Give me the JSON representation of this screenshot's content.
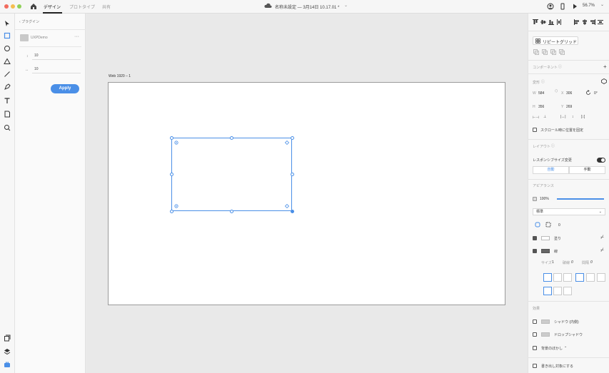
{
  "titlebar": {
    "tabs": [
      "デザイン",
      "プロトタイプ",
      "共有"
    ],
    "document_title": "名称未設定 — 3月14日 10.17.01 *",
    "zoom": "56.7%"
  },
  "plugin_panel": {
    "back_label": "プラグイン",
    "plugin_name": "UXPDemo",
    "more": "···",
    "fields": [
      {
        "label": "↕",
        "value": "10"
      },
      {
        "label": "↔",
        "value": "10"
      }
    ],
    "apply_label": "Apply"
  },
  "canvas": {
    "artboard_label": "Web 1920 – 1"
  },
  "right_panel": {
    "repeat_grid_label": "リピートグリッド",
    "component_label": "コンポーネント",
    "transform_label": "変形",
    "w_label": "W",
    "w_value": "584",
    "x_label": "X",
    "x_value": "306",
    "rotation_value": "0°",
    "h_label": "H",
    "h_value": "356",
    "y_label": "Y",
    "y_value": "269",
    "fix_scroll_label": "スクロール時に位置を固定",
    "layout_label": "レイアウト",
    "responsive_label": "レスポンシブサイズ変更",
    "auto_label": "自動",
    "manual_label": "手動",
    "appearance_label": "アピアランス",
    "opacity_value": "100%",
    "blend_mode": "標準",
    "corner_value": "0",
    "fill_label": "塗り",
    "border_label": "線",
    "size_label": "サイズ",
    "size_value": "1",
    "dash_label": "破線",
    "dash_value": "0",
    "gap_label": "間隔",
    "gap_value": "0",
    "effects_label": "効果",
    "inner_shadow_label": "シャドウ (内側)",
    "drop_shadow_label": "ドロップシャドウ",
    "bg_blur_label": "背景のぼかし",
    "overwrite_label": "書き出し対象にする",
    "accent_color": "#4a8fe7"
  }
}
